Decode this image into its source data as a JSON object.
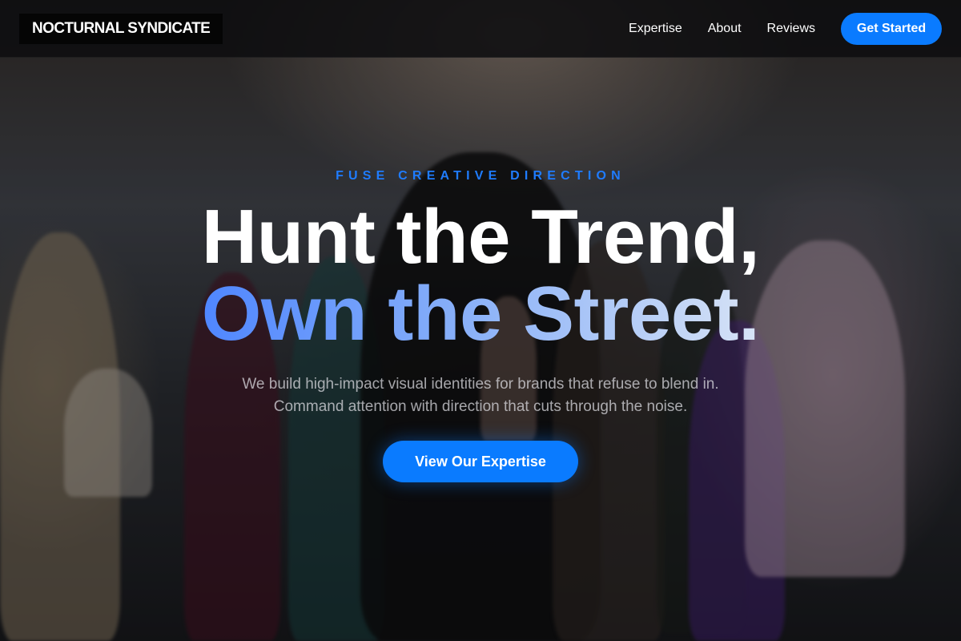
{
  "nav": {
    "brand": "NOCTURNAL SYNDICATE",
    "links": [
      {
        "label": "Expertise"
      },
      {
        "label": "About"
      },
      {
        "label": "Reviews"
      }
    ],
    "cta_label": "Get Started"
  },
  "hero": {
    "eyebrow": "FUSE CREATIVE DIRECTION",
    "headline_line1": "Hunt the Trend,",
    "headline_line2": "Own the Street.",
    "subtext_line1": "We build high-impact visual identities for brands that refuse to blend in.",
    "subtext_line2": "Command attention with direction that cuts through the noise.",
    "cta_label": "View Our Expertise"
  },
  "colors": {
    "accent": "#0a7bff",
    "gradient_start": "#4f86ff",
    "gradient_end": "#d7e3f6",
    "nav_bg": "#0e0e10"
  }
}
